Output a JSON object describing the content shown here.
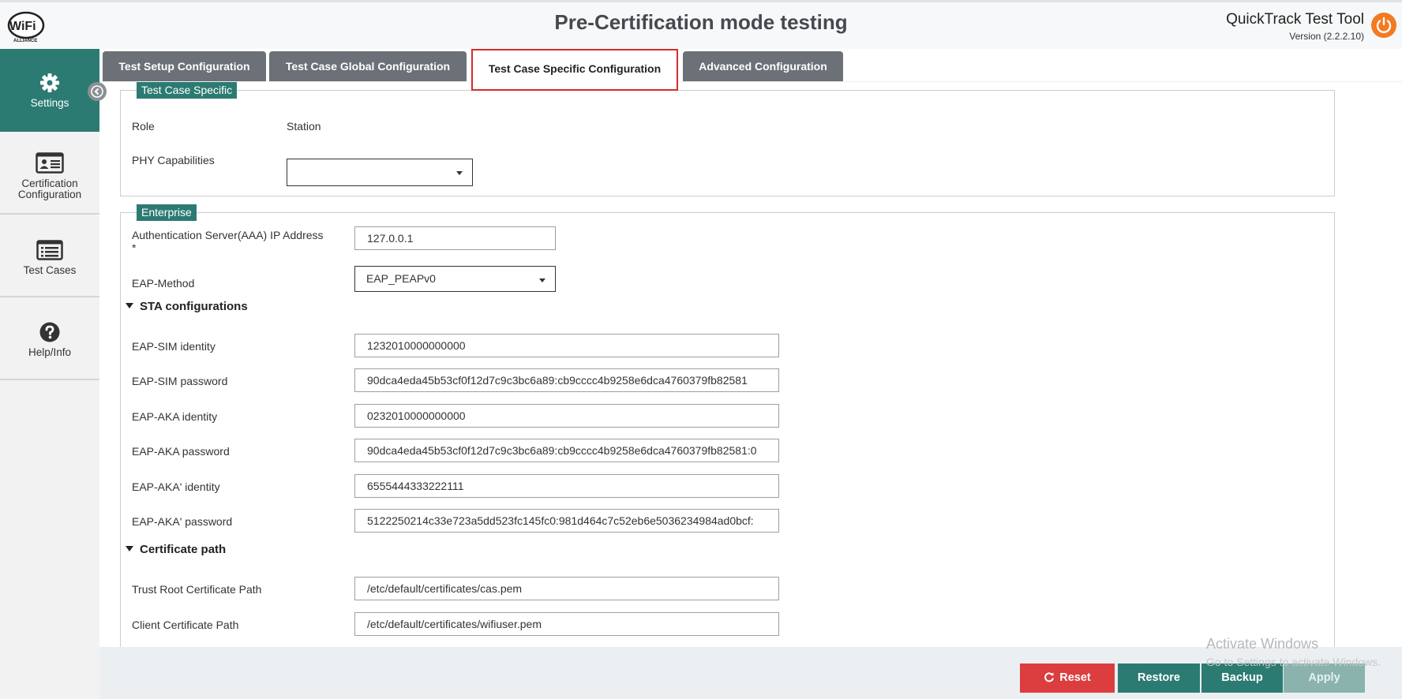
{
  "header": {
    "title": "Pre-Certification mode testing",
    "app_name": "QuickTrack Test Tool",
    "version": "Version (2.2.2.10)",
    "logo_text": "WiFi",
    "logo_subtext": "ALLIANCE"
  },
  "sidebar": {
    "items": [
      {
        "label": "Settings",
        "icon": "gear-icon"
      },
      {
        "label": "Certification Configuration",
        "icon": "id-card-icon"
      },
      {
        "label": "Test Cases",
        "icon": "list-icon"
      },
      {
        "label": "Help/Info",
        "icon": "question-icon"
      }
    ]
  },
  "tabs": [
    {
      "label": "Test Setup Configuration"
    },
    {
      "label": "Test Case Global Configuration"
    },
    {
      "label": "Test Case Specific Configuration",
      "active": true
    },
    {
      "label": "Advanced Configuration"
    }
  ],
  "specific": {
    "legend": "Test Case Specific",
    "role_label": "Role",
    "role_value": "Station",
    "phy_label": "PHY Capabilities",
    "phy_value": ""
  },
  "enterprise": {
    "legend": "Enterprise",
    "aaa_label": "Authentication Server(AAA) IP Address",
    "aaa_required": "*",
    "aaa_value": "127.0.0.1",
    "eap_method_label": "EAP-Method",
    "eap_method_value": "EAP_PEAPv0",
    "sta_section": "STA configurations",
    "fields": [
      {
        "label": "EAP-SIM identity",
        "value": "1232010000000000"
      },
      {
        "label": "EAP-SIM password",
        "value": "90dca4eda45b53cf0f12d7c9c3bc6a89:cb9cccc4b9258e6dca4760379fb82581"
      },
      {
        "label": "EAP-AKA identity",
        "value": "0232010000000000"
      },
      {
        "label": "EAP-AKA password",
        "value": "90dca4eda45b53cf0f12d7c9c3bc6a89:cb9cccc4b9258e6dca4760379fb82581:0"
      },
      {
        "label": "EAP-AKA' identity",
        "value": "6555444333222111"
      },
      {
        "label": "EAP-AKA' password",
        "value": "5122250214c33e723a5dd523fc145fc0:981d464c7c52eb6e5036234984ad0bcf:"
      }
    ],
    "cert_section": "Certificate path",
    "cert_fields": [
      {
        "label": "Trust Root Certificate Path",
        "value": "/etc/default/certificates/cas.pem"
      },
      {
        "label": "Client Certificate Path",
        "value": "/etc/default/certificates/wifiuser.pem"
      }
    ]
  },
  "footer": {
    "reset": "Reset",
    "restore": "Restore",
    "backup": "Backup",
    "apply": "Apply"
  },
  "watermark": {
    "line1": "Activate Windows",
    "line2": "Go to Settings to activate Windows."
  },
  "colors": {
    "accent": "#2c7b72",
    "tab_inactive": "#6b7177",
    "danger": "#dc3d3f",
    "power": "#f37a22",
    "highlight_border": "#d62b2b"
  }
}
